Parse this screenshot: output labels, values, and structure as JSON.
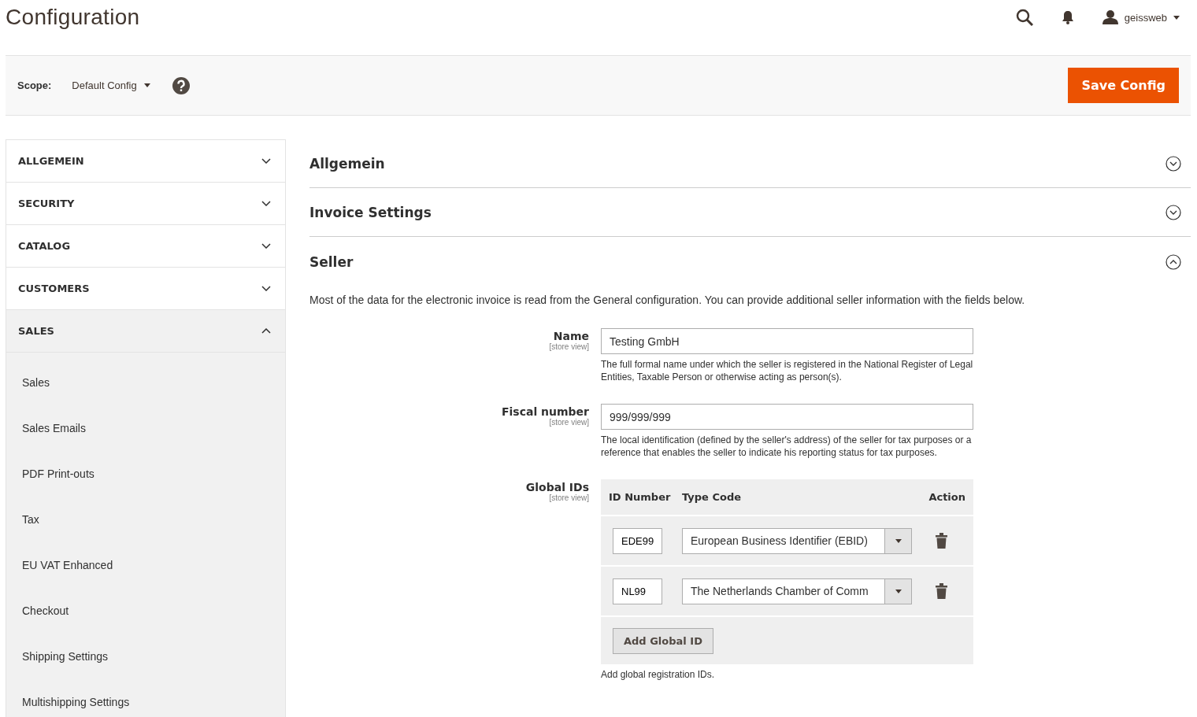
{
  "page_title": "Configuration",
  "header": {
    "user": "geissweb"
  },
  "scope": {
    "label": "Scope:",
    "value": "Default Config"
  },
  "save_button": "Save Config",
  "sidebar": [
    {
      "label": "ALLGEMEIN",
      "expanded": false
    },
    {
      "label": "SECURITY",
      "expanded": false
    },
    {
      "label": "CATALOG",
      "expanded": false
    },
    {
      "label": "CUSTOMERS",
      "expanded": false
    },
    {
      "label": "SALES",
      "expanded": true,
      "items": [
        "Sales",
        "Sales Emails",
        "PDF Print-outs",
        "Tax",
        "EU VAT Enhanced",
        "Checkout",
        "Shipping Settings",
        "Multishipping Settings"
      ]
    }
  ],
  "sections": [
    {
      "title": "Allgemein",
      "expanded": false
    },
    {
      "title": "Invoice Settings",
      "expanded": false
    },
    {
      "title": "Seller",
      "expanded": true,
      "intro": "Most of the data for the electronic invoice is read from the General configuration. You can provide additional seller information with the fields below.",
      "fields": [
        {
          "kind": "text",
          "label": "Name",
          "scope": "[store view]",
          "value": "Testing GmbH",
          "note": "The full formal name under which the seller is registered in the National Register of Legal Entities, Taxable Person or otherwise acting as person(s)."
        },
        {
          "kind": "text",
          "label": "Fiscal number",
          "scope": "[store view]",
          "value": "999/999/999",
          "note": "The local identification (defined by the seller's address) of the seller for tax purposes or a reference that enables the seller to indicate his reporting status for tax purposes."
        },
        {
          "kind": "grid",
          "label": "Global IDs",
          "scope": "[store view]",
          "columns": [
            "ID Number",
            "Type Code",
            "Action"
          ],
          "rows": [
            {
              "id": "EDE99",
              "type": "European Business Identifier (EBID)"
            },
            {
              "id": "NL99",
              "type": "The Netherlands Chamber of Comm"
            }
          ],
          "add_button": "Add Global ID",
          "note": "Add global registration IDs."
        }
      ]
    }
  ]
}
